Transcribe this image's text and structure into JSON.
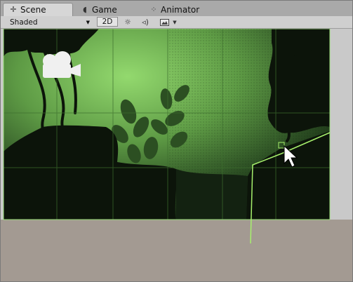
{
  "tabs": [
    {
      "label": "Scene",
      "icon": "crosshair-icon",
      "active": true
    },
    {
      "label": "Game",
      "icon": "pacman-icon",
      "active": false
    },
    {
      "label": "Animator",
      "icon": "nodes-icon",
      "active": false
    }
  ],
  "toolbar": {
    "shading_mode": "Shaded",
    "mode_2d": "2D",
    "icons": [
      "sun-icon",
      "audio-icon",
      "image-effects-icon",
      "dropdown-arrow-icon"
    ]
  },
  "colors": {
    "forest_light": "#8fd26a",
    "forest_mid": "#4f8c3a",
    "forest_dark": "#1b3114",
    "silhouette": "#0c140a",
    "ground": "#a39a92",
    "camera_bounds": "#9be07a",
    "collider_line": "#a6f06c"
  }
}
